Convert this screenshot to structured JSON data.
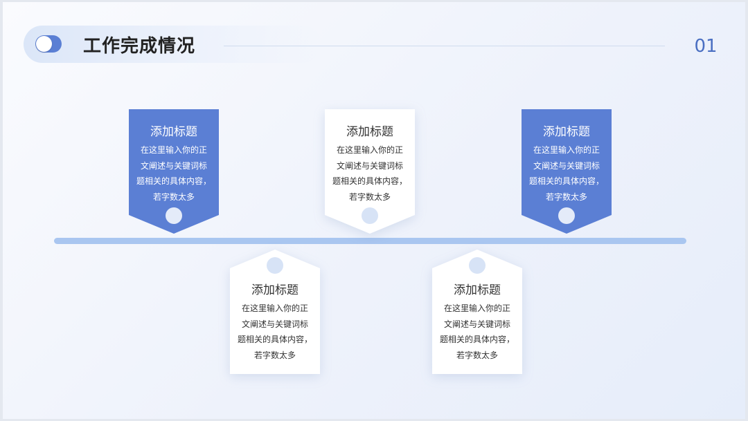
{
  "header": {
    "title": "工作完成情况",
    "page_number": "01"
  },
  "colors": {
    "accent": "#5b7fd4",
    "timeline": "#a9c6f0",
    "card_white": "#ffffff",
    "text_dark": "#333333"
  },
  "cards": [
    {
      "title": "添加标题",
      "body": "在这里输入你的正\n文阐述与关键词标\n题相关的具体内容，\n若字数太多",
      "style": "blue",
      "position": "above"
    },
    {
      "title": "添加标题",
      "body": "在这里输入你的正\n文阐述与关键词标\n题相关的具体内容，\n若字数太多",
      "style": "white",
      "position": "below"
    },
    {
      "title": "添加标题",
      "body": "在这里输入你的正\n文阐述与关键词标\n题相关的具体内容，\n若字数太多",
      "style": "white",
      "position": "above"
    },
    {
      "title": "添加标题",
      "body": "在这里输入你的正\n文阐述与关键词标\n题相关的具体内容，\n若字数太多",
      "style": "white",
      "position": "below"
    },
    {
      "title": "添加标题",
      "body": "在这里输入你的正\n文阐述与关键词标\n题相关的具体内容，\n若字数太多",
      "style": "blue",
      "position": "above"
    }
  ]
}
